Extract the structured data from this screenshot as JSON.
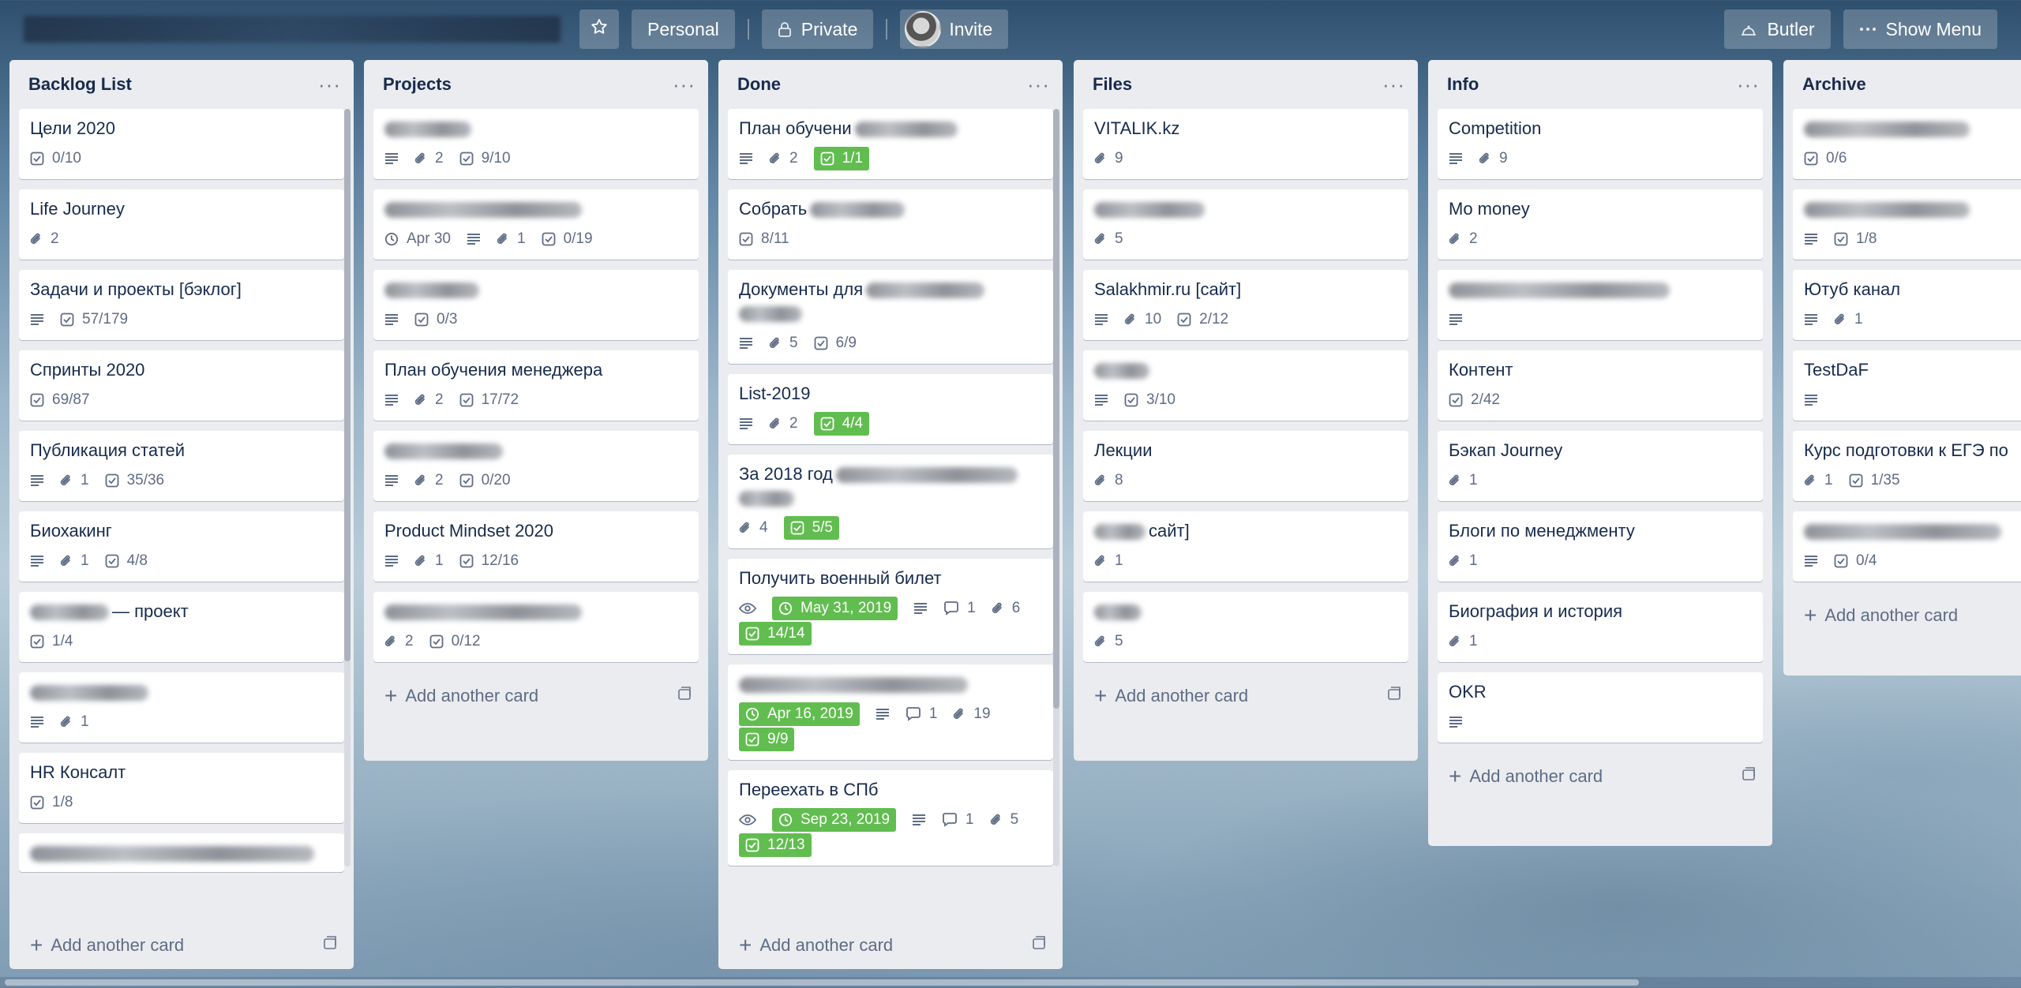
{
  "header": {
    "star_icon": "star-icon",
    "personal": "Personal",
    "private": "Private",
    "invite": "Invite",
    "butler": "Butler",
    "show_menu": "Show Menu"
  },
  "lists": [
    {
      "title": "Backlog List",
      "add_label": "Add another card",
      "cards": [
        {
          "title": "Цели 2020",
          "badges": [
            {
              "icon": "checklist-icon",
              "text": "0/10"
            }
          ]
        },
        {
          "title": "Life Journey",
          "badges": [
            {
              "icon": "attachment-icon",
              "text": "2"
            }
          ]
        },
        {
          "title": "Задачи и проекты [бэклог]",
          "badges": [
            {
              "icon": "description-icon",
              "text": ""
            },
            {
              "icon": "checklist-icon",
              "text": "57/179"
            }
          ]
        },
        {
          "title": "Спринты 2020",
          "badges": [
            {
              "icon": "checklist-icon",
              "text": "69/87"
            }
          ]
        },
        {
          "title": "Публикация статей",
          "badges": [
            {
              "icon": "description-icon",
              "text": ""
            },
            {
              "icon": "attachment-icon",
              "text": "1"
            },
            {
              "icon": "checklist-icon",
              "text": "35/36"
            }
          ]
        },
        {
          "title": "Биохакинг",
          "badges": [
            {
              "icon": "description-icon",
              "text": ""
            },
            {
              "icon": "attachment-icon",
              "text": "1"
            },
            {
              "icon": "checklist-icon",
              "text": "4/8"
            }
          ]
        },
        {
          "title": "— проект",
          "blur_prefix": 100,
          "badges": [
            {
              "icon": "checklist-icon",
              "text": "1/4"
            }
          ]
        },
        {
          "title": "",
          "blur": 150,
          "badges": [
            {
              "icon": "description-icon",
              "text": ""
            },
            {
              "icon": "attachment-icon",
              "text": "1"
            }
          ]
        },
        {
          "title": "HR Консалт",
          "badges": [
            {
              "icon": "checklist-icon",
              "text": "1/8"
            }
          ]
        },
        {
          "title": "",
          "blur": 360,
          "badges": []
        }
      ]
    },
    {
      "title": "Projects",
      "add_label": "Add another card",
      "cards": [
        {
          "title": "",
          "blur": 110,
          "badges": [
            {
              "icon": "description-icon",
              "text": ""
            },
            {
              "icon": "attachment-icon",
              "text": "2"
            },
            {
              "icon": "checklist-icon",
              "text": "9/10"
            }
          ]
        },
        {
          "title": "",
          "blur": 250,
          "badges": [
            {
              "icon": "clock-icon",
              "text": "Apr 30"
            },
            {
              "icon": "description-icon",
              "text": ""
            },
            {
              "icon": "attachment-icon",
              "text": "1"
            },
            {
              "icon": "checklist-icon",
              "text": "0/19"
            }
          ]
        },
        {
          "title": "",
          "blur": 120,
          "badges": [
            {
              "icon": "description-icon",
              "text": ""
            },
            {
              "icon": "checklist-icon",
              "text": "0/3"
            }
          ]
        },
        {
          "title": "План обучения менеджера",
          "badges": [
            {
              "icon": "description-icon",
              "text": ""
            },
            {
              "icon": "attachment-icon",
              "text": "2"
            },
            {
              "icon": "checklist-icon",
              "text": "17/72"
            }
          ]
        },
        {
          "title": "",
          "blur": 150,
          "badges": [
            {
              "icon": "description-icon",
              "text": ""
            },
            {
              "icon": "attachment-icon",
              "text": "2"
            },
            {
              "icon": "checklist-icon",
              "text": "0/20"
            }
          ]
        },
        {
          "title": "Product Mindset 2020",
          "badges": [
            {
              "icon": "description-icon",
              "text": ""
            },
            {
              "icon": "attachment-icon",
              "text": "1"
            },
            {
              "icon": "checklist-icon",
              "text": "12/16"
            }
          ]
        },
        {
          "title": "",
          "blur": 250,
          "badges": [
            {
              "icon": "attachment-icon",
              "text": "2"
            },
            {
              "icon": "checklist-icon",
              "text": "0/12"
            }
          ]
        }
      ]
    },
    {
      "title": "Done",
      "add_label": "Add another card",
      "cards": [
        {
          "title": "План обучени",
          "blur_suffix": 130,
          "badges": [
            {
              "icon": "description-icon",
              "text": ""
            },
            {
              "icon": "attachment-icon",
              "text": "2"
            },
            {
              "icon": "checklist-icon",
              "text": "1/1",
              "complete": true
            }
          ]
        },
        {
          "title": "Собрать",
          "blur_suffix": 120,
          "badges": [
            {
              "icon": "checklist-icon",
              "text": "8/11"
            }
          ]
        },
        {
          "title": "Документы для",
          "blur_suffix": 150,
          "blur_line2": 80,
          "badges": [
            {
              "icon": "description-icon",
              "text": ""
            },
            {
              "icon": "attachment-icon",
              "text": "5"
            },
            {
              "icon": "checklist-icon",
              "text": "6/9"
            }
          ]
        },
        {
          "title": "List-2019",
          "badges": [
            {
              "icon": "description-icon",
              "text": ""
            },
            {
              "icon": "attachment-icon",
              "text": "2"
            },
            {
              "icon": "checklist-icon",
              "text": "4/4",
              "complete": true
            }
          ]
        },
        {
          "title": "За 2018 год",
          "blur_suffix": 230,
          "blur_line2": 70,
          "badges": [
            {
              "icon": "attachment-icon",
              "text": "4"
            },
            {
              "icon": "checklist-icon",
              "text": "5/5",
              "complete": true
            }
          ]
        },
        {
          "title": "Получить военный билет",
          "badges": [
            {
              "icon": "eye-icon",
              "text": ""
            },
            {
              "icon": "clock-icon",
              "text": "May 31, 2019",
              "complete": true
            },
            {
              "icon": "description-icon",
              "text": ""
            },
            {
              "icon": "comment-icon",
              "text": "1"
            },
            {
              "icon": "attachment-icon",
              "text": "6"
            },
            {
              "icon": "checklist-icon",
              "text": "14/14",
              "complete": true
            }
          ]
        },
        {
          "title": "",
          "blur": 290,
          "badges": [
            {
              "icon": "clock-icon",
              "text": "Apr 16, 2019",
              "complete": true
            },
            {
              "icon": "description-icon",
              "text": ""
            },
            {
              "icon": "comment-icon",
              "text": "1"
            },
            {
              "icon": "attachment-icon",
              "text": "19"
            },
            {
              "icon": "checklist-icon",
              "text": "9/9",
              "complete": true
            }
          ]
        },
        {
          "title": "Переехать в СПб",
          "badges": [
            {
              "icon": "eye-icon",
              "text": ""
            },
            {
              "icon": "clock-icon",
              "text": "Sep 23, 2019",
              "complete": true
            },
            {
              "icon": "description-icon",
              "text": ""
            },
            {
              "icon": "comment-icon",
              "text": "1"
            },
            {
              "icon": "attachment-icon",
              "text": "5"
            },
            {
              "icon": "checklist-icon",
              "text": "12/13",
              "complete": true
            }
          ]
        }
      ]
    },
    {
      "title": "Files",
      "add_label": "Add another card",
      "cards": [
        {
          "title": "VITALIK.kz",
          "badges": [
            {
              "icon": "attachment-icon",
              "text": "9"
            }
          ]
        },
        {
          "title": "",
          "blur": 140,
          "badges": [
            {
              "icon": "attachment-icon",
              "text": "5"
            }
          ]
        },
        {
          "title": "Salakhmir.ru [сайт]",
          "badges": [
            {
              "icon": "description-icon",
              "text": ""
            },
            {
              "icon": "attachment-icon",
              "text": "10"
            },
            {
              "icon": "checklist-icon",
              "text": "2/12"
            }
          ]
        },
        {
          "title": "",
          "blur": 70,
          "badges": [
            {
              "icon": "description-icon",
              "text": ""
            },
            {
              "icon": "checklist-icon",
              "text": "3/10"
            }
          ]
        },
        {
          "title": "Лекции",
          "badges": [
            {
              "icon": "attachment-icon",
              "text": "8"
            }
          ]
        },
        {
          "title": "сайт]",
          "blur_prefix": 65,
          "badges": [
            {
              "icon": "attachment-icon",
              "text": "1"
            }
          ]
        },
        {
          "title": "",
          "blur": 60,
          "badges": [
            {
              "icon": "attachment-icon",
              "text": "5"
            }
          ]
        }
      ]
    },
    {
      "title": "Info",
      "add_label": "Add another card",
      "cards": [
        {
          "title": "Competition",
          "badges": [
            {
              "icon": "description-icon",
              "text": ""
            },
            {
              "icon": "attachment-icon",
              "text": "9"
            }
          ]
        },
        {
          "title": "Mo money",
          "badges": [
            {
              "icon": "attachment-icon",
              "text": "2"
            }
          ]
        },
        {
          "title": "",
          "blur": 280,
          "badges": [
            {
              "icon": "description-icon",
              "text": ""
            }
          ]
        },
        {
          "title": "Контент",
          "badges": [
            {
              "icon": "checklist-icon",
              "text": "2/42"
            }
          ]
        },
        {
          "title": "Бэкап Journey",
          "badges": [
            {
              "icon": "attachment-icon",
              "text": "1"
            }
          ]
        },
        {
          "title": "Блоги по менеджменту",
          "badges": [
            {
              "icon": "attachment-icon",
              "text": "1"
            }
          ]
        },
        {
          "title": "Биография и история",
          "badges": [
            {
              "icon": "attachment-icon",
              "text": "1"
            }
          ]
        },
        {
          "title": "OKR",
          "badges": [
            {
              "icon": "description-icon",
              "text": ""
            }
          ]
        }
      ]
    },
    {
      "title": "Archive",
      "add_label": "Add another card",
      "cards": [
        {
          "title": "",
          "blur": 210,
          "badges": [
            {
              "icon": "checklist-icon",
              "text": "0/6"
            }
          ]
        },
        {
          "title": "",
          "blur": 210,
          "badges": [
            {
              "icon": "description-icon",
              "text": ""
            },
            {
              "icon": "checklist-icon",
              "text": "1/8"
            }
          ]
        },
        {
          "title": "Ютуб канал",
          "badges": [
            {
              "icon": "description-icon",
              "text": ""
            },
            {
              "icon": "attachment-icon",
              "text": "1"
            }
          ]
        },
        {
          "title": "TestDaF",
          "badges": [
            {
              "icon": "description-icon",
              "text": ""
            }
          ]
        },
        {
          "title": "Курс подготовки к ЕГЭ по",
          "badges": [
            {
              "icon": "attachment-icon",
              "text": "1"
            },
            {
              "icon": "checklist-icon",
              "text": "1/35"
            }
          ]
        },
        {
          "title": "",
          "blur": 250,
          "badges": [
            {
              "icon": "description-icon",
              "text": ""
            },
            {
              "icon": "checklist-icon",
              "text": "0/4"
            }
          ]
        }
      ]
    }
  ]
}
